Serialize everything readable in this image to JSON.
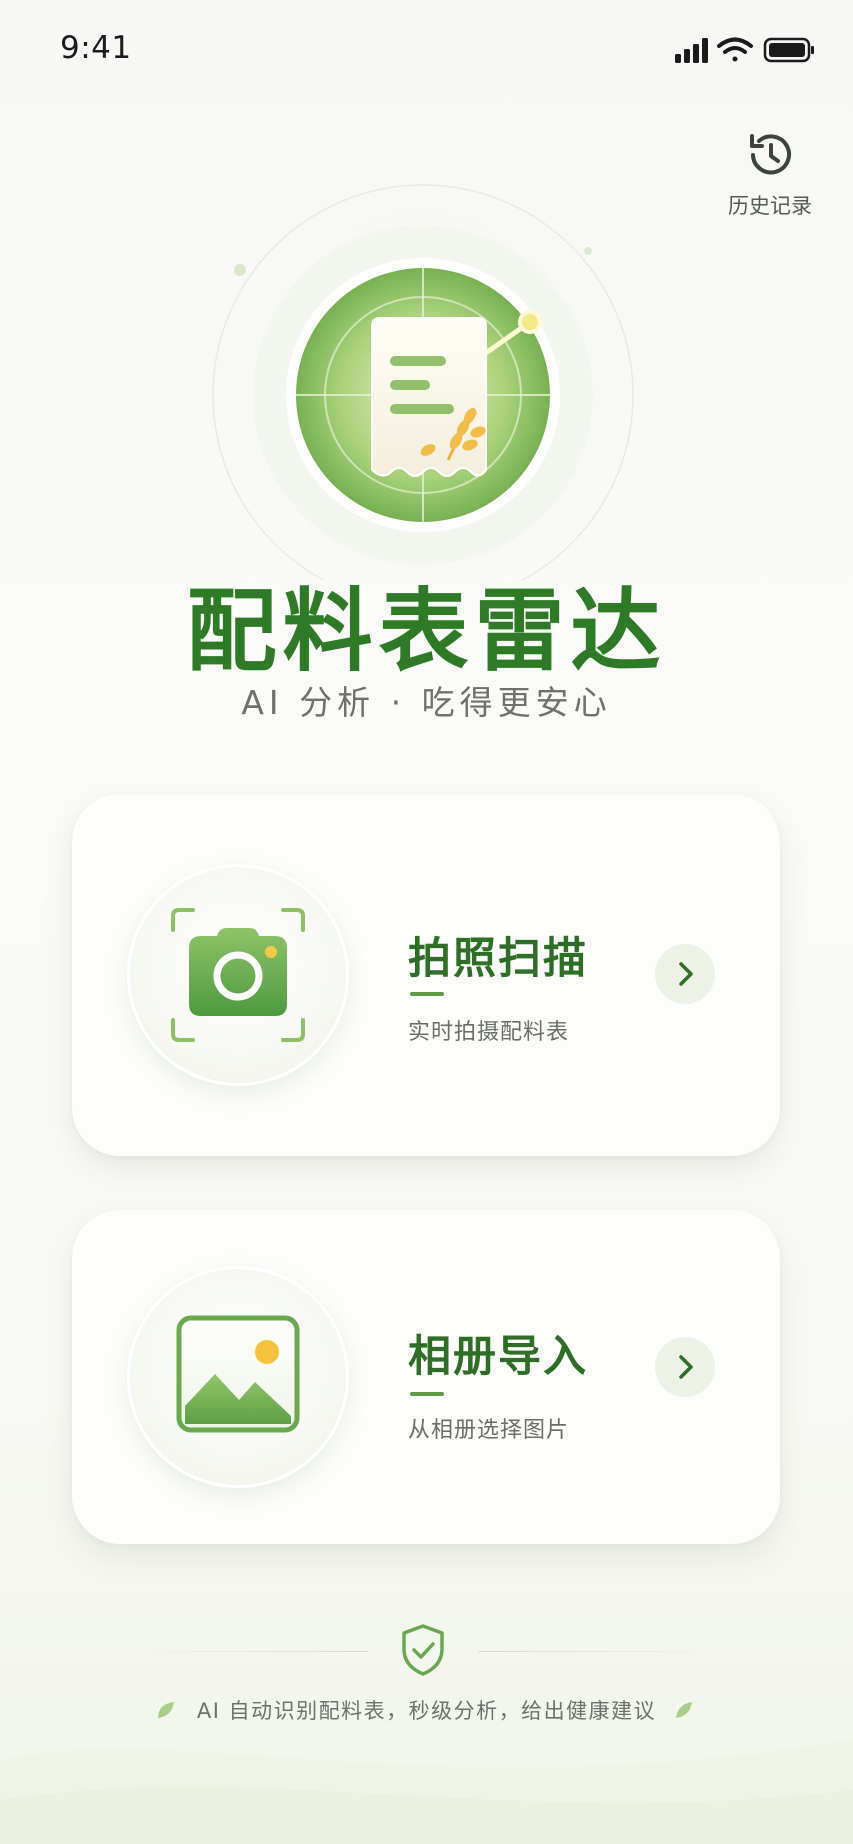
{
  "status_bar": {
    "time": "9:41"
  },
  "header": {
    "history_label": "历史记录"
  },
  "hero": {
    "title": "配料表雷达",
    "subtitle": "AI 分析 · 吃得更安心"
  },
  "actions": [
    {
      "title": "拍照扫描",
      "description": "实时拍摄配料表",
      "icon": "camera-icon"
    },
    {
      "title": "相册导入",
      "description": "从相册选择图片",
      "icon": "image-icon"
    }
  ],
  "footer": {
    "text": "AI 自动识别配料表，秒级分析，给出健康建议"
  },
  "colors": {
    "brand_green": "#2f7a26",
    "light_green": "#8cc262",
    "accent_yellow": "#f2c04a",
    "background": "#f8f9f6"
  }
}
